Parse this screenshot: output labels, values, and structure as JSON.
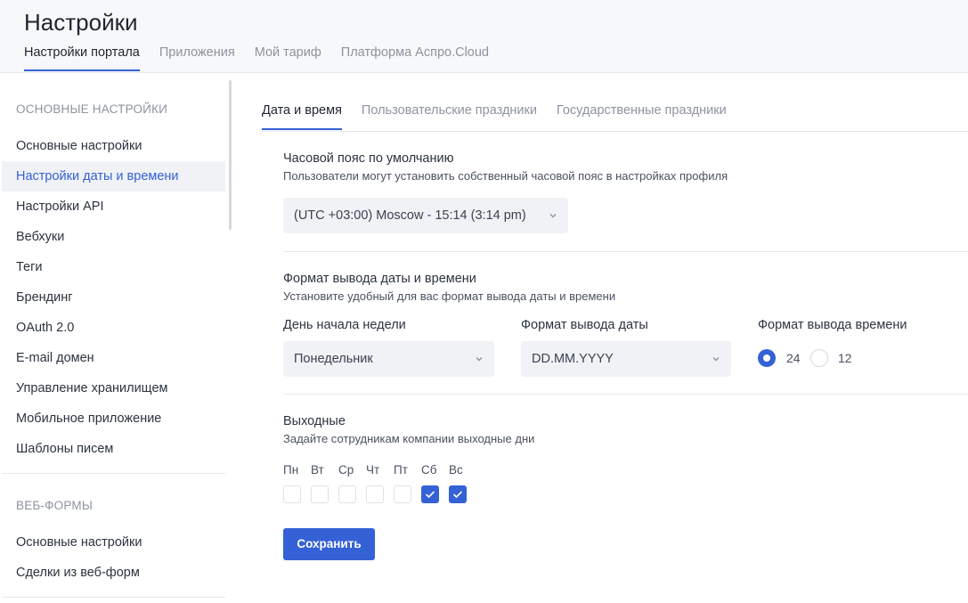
{
  "header": {
    "title": "Настройки",
    "tabs": [
      {
        "label": "Настройки портала",
        "active": true
      },
      {
        "label": "Приложения",
        "active": false
      },
      {
        "label": "Мой тариф",
        "active": false
      },
      {
        "label": "Платформа Аспро.Cloud",
        "active": false
      }
    ]
  },
  "sidebar": {
    "section1": {
      "heading": "Основные настройки",
      "items": [
        {
          "label": "Основные настройки",
          "active": false
        },
        {
          "label": "Настройки даты и времени",
          "active": true
        },
        {
          "label": "Настройки API",
          "active": false
        },
        {
          "label": "Вебхуки",
          "active": false
        },
        {
          "label": "Теги",
          "active": false
        },
        {
          "label": "Брендинг",
          "active": false
        },
        {
          "label": "OAuth 2.0",
          "active": false
        },
        {
          "label": "E-mail домен",
          "active": false
        },
        {
          "label": "Управление хранилищем",
          "active": false
        },
        {
          "label": "Мобильное приложение",
          "active": false
        },
        {
          "label": "Шаблоны писем",
          "active": false
        }
      ]
    },
    "section2": {
      "heading": "Веб-формы",
      "items": [
        {
          "label": "Основные настройки",
          "active": false
        },
        {
          "label": "Сделки из веб-форм",
          "active": false
        }
      ]
    }
  },
  "main": {
    "tabs": [
      {
        "label": "Дата и время",
        "active": true
      },
      {
        "label": "Пользовательские праздники",
        "active": false
      },
      {
        "label": "Государственные праздники",
        "active": false
      }
    ],
    "timezone": {
      "title": "Часовой пояс по умолчанию",
      "subtitle": "Пользователи могут установить собственный часовой пояс в настройках профиля",
      "value": "(UTC +03:00) Moscow - 15:14 (3:14 pm)"
    },
    "format": {
      "title": "Формат вывода даты и времени",
      "subtitle": "Установите удобный для вас формат вывода даты и времени",
      "week_start_label": "День начала недели",
      "week_start_value": "Понедельник",
      "date_format_label": "Формат вывода даты",
      "date_format_value": "DD.MM.YYYY",
      "time_format_label": "Формат вывода времени",
      "time_options": [
        {
          "label": "24",
          "selected": true
        },
        {
          "label": "12",
          "selected": false
        }
      ]
    },
    "weekends": {
      "title": "Выходные",
      "subtitle": "Задайте сотрудникам компании выходные дни",
      "days": [
        {
          "label": "Пн",
          "checked": false
        },
        {
          "label": "Вт",
          "checked": false
        },
        {
          "label": "Ср",
          "checked": false
        },
        {
          "label": "Чт",
          "checked": false
        },
        {
          "label": "Пт",
          "checked": false
        },
        {
          "label": "Сб",
          "checked": true
        },
        {
          "label": "Вс",
          "checked": true
        }
      ]
    },
    "save_label": "Сохранить"
  },
  "colors": {
    "accent": "#3461d6",
    "muted_text": "#8d93a0",
    "panel_bg": "#f0f2f6"
  },
  "icons": {
    "select_chevron": "chevron-down-icon",
    "checkbox_check": "check-icon"
  }
}
